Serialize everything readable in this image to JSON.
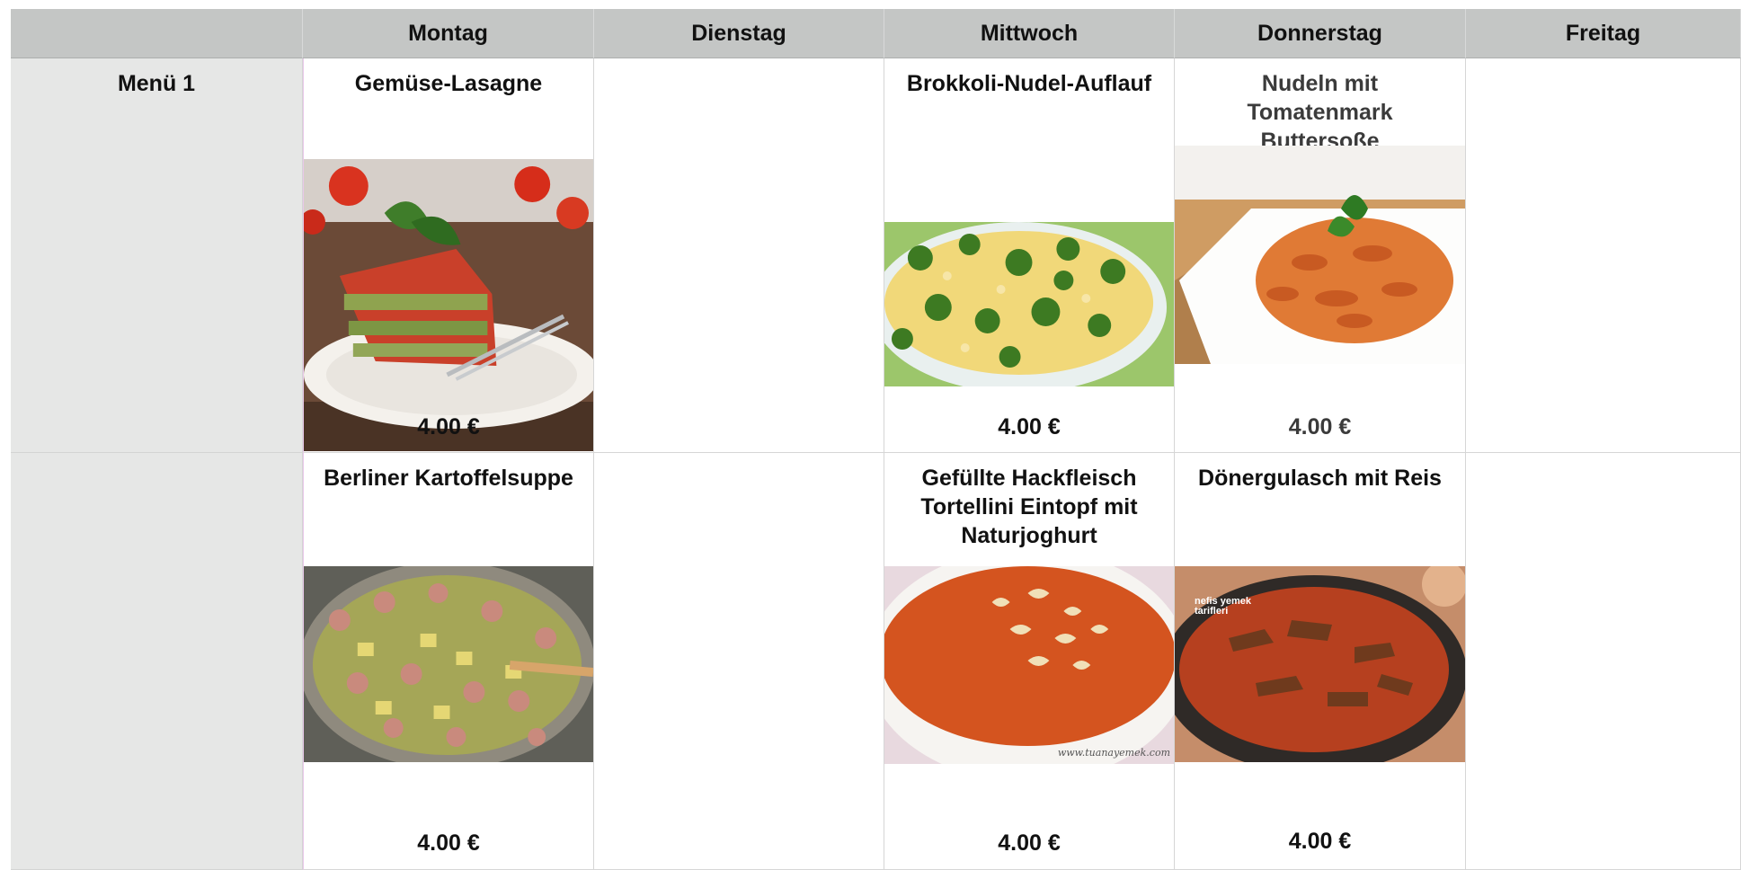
{
  "header": {
    "corner": "",
    "days": [
      "Montag",
      "Dienstag",
      "Mittwoch",
      "Donnerstag",
      "Freitag"
    ]
  },
  "rows": [
    {
      "label": "Menü 1",
      "montag": {
        "title": "Gemüse-Lasagne",
        "price": "4.00 €",
        "image": "lasagne-photo"
      },
      "mittwoch": {
        "title": "Brokkoli-Nudel-Auflauf",
        "price": "4.00 €",
        "image": "broccoli-casserole-photo"
      },
      "donnerstag": {
        "title": "Nudeln mit Tomatenmark Buttersoße",
        "price": "4.00 €",
        "image": "fusilli-tomato-photo"
      }
    },
    {
      "label": "",
      "montag": {
        "title": "Berliner Kartoffelsuppe",
        "price": "4.00 €",
        "image": "potato-soup-photo"
      },
      "mittwoch": {
        "title": "Gefüllte Hackfleisch Tortellini Eintopf mit Naturjoghurt",
        "price": "4.00 €",
        "image": "tortellini-soup-photo",
        "watermark": "www.tuanayemek.com"
      },
      "donnerstag": {
        "title": "Dönergulasch mit Reis",
        "price": "4.00 €",
        "image": "doner-goulash-photo",
        "watermark": "nefis yemek tarifleri"
      }
    }
  ]
}
